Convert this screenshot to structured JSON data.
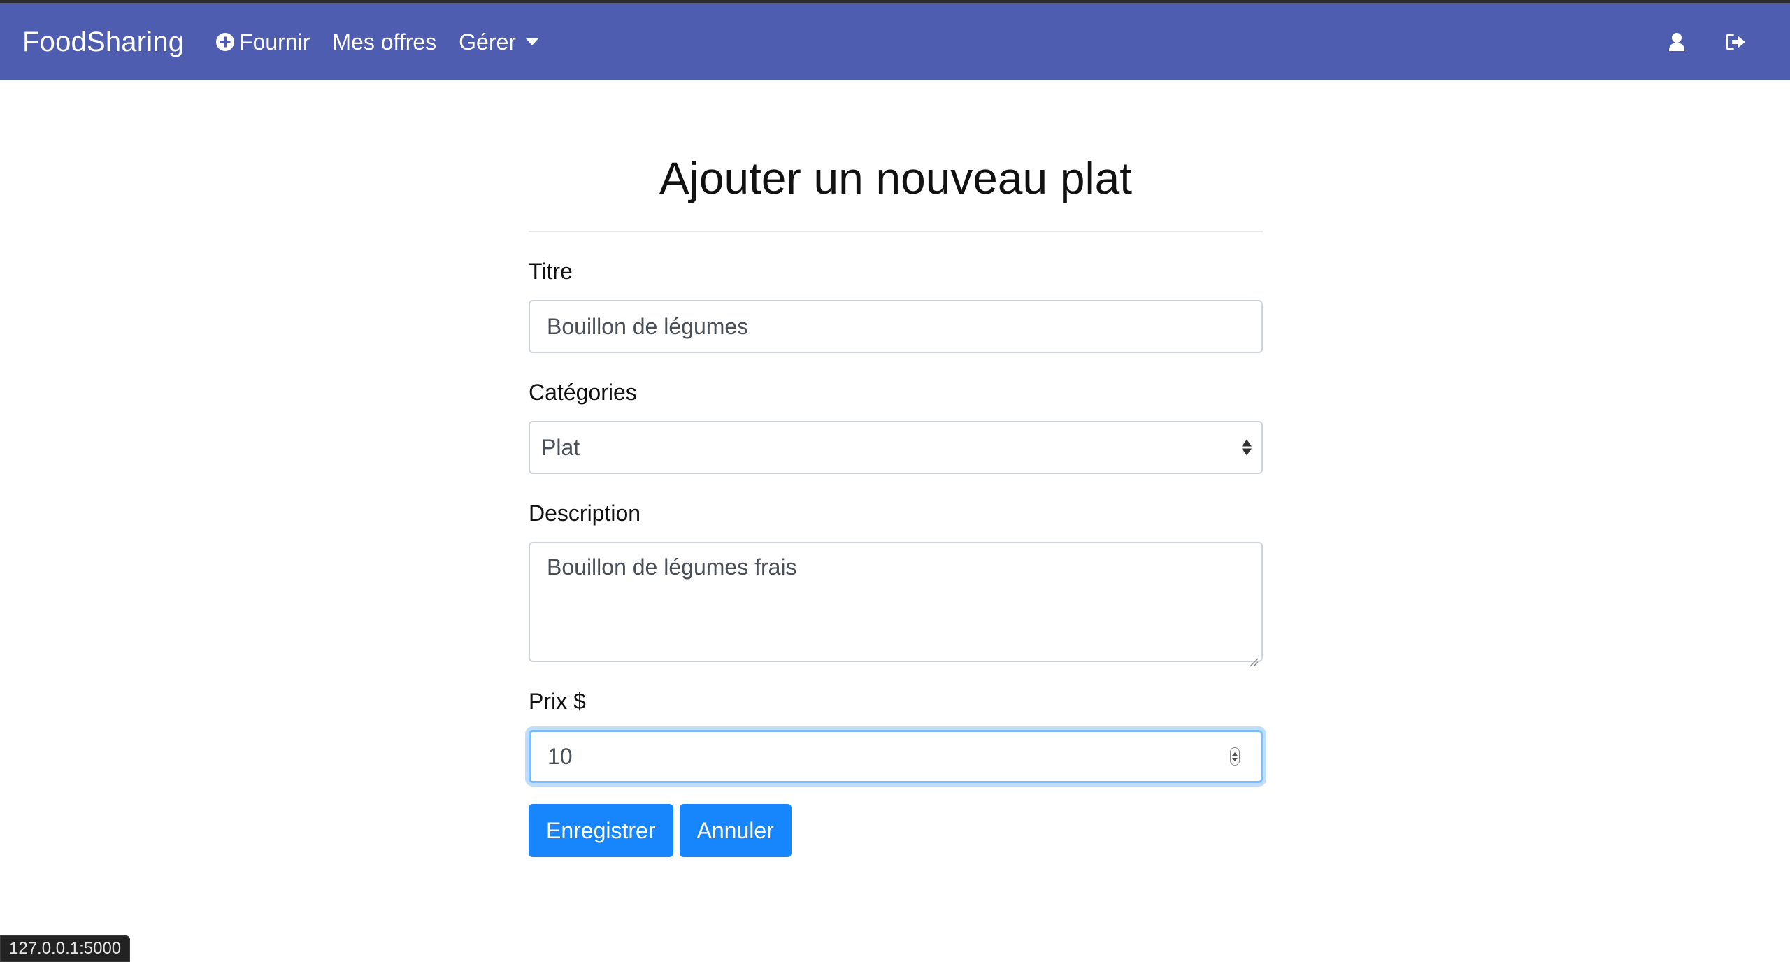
{
  "navbar": {
    "brand": "FoodSharing",
    "links": [
      {
        "label": "Fournir",
        "icon": "plus-circle-icon"
      },
      {
        "label": "Mes offres"
      },
      {
        "label": "Gérer",
        "icon": "caret-down-icon"
      }
    ],
    "right_icons": [
      "user-icon",
      "sign-out-icon"
    ],
    "background": "#4e5db0"
  },
  "form": {
    "title": "Ajouter un nouveau plat",
    "fields": {
      "titre": {
        "label": "Titre",
        "value": "Bouillon de légumes"
      },
      "categories": {
        "label": "Catégories",
        "value": "Plat"
      },
      "description": {
        "label": "Description",
        "value": "Bouillon de légumes frais"
      },
      "prix": {
        "label": "Prix $",
        "value": "10"
      }
    },
    "buttons": {
      "save": "Enregistrer",
      "cancel": "Annuler"
    },
    "accent": "#1785fb"
  },
  "status_bar": {
    "url": "127.0.0.1:5000"
  }
}
